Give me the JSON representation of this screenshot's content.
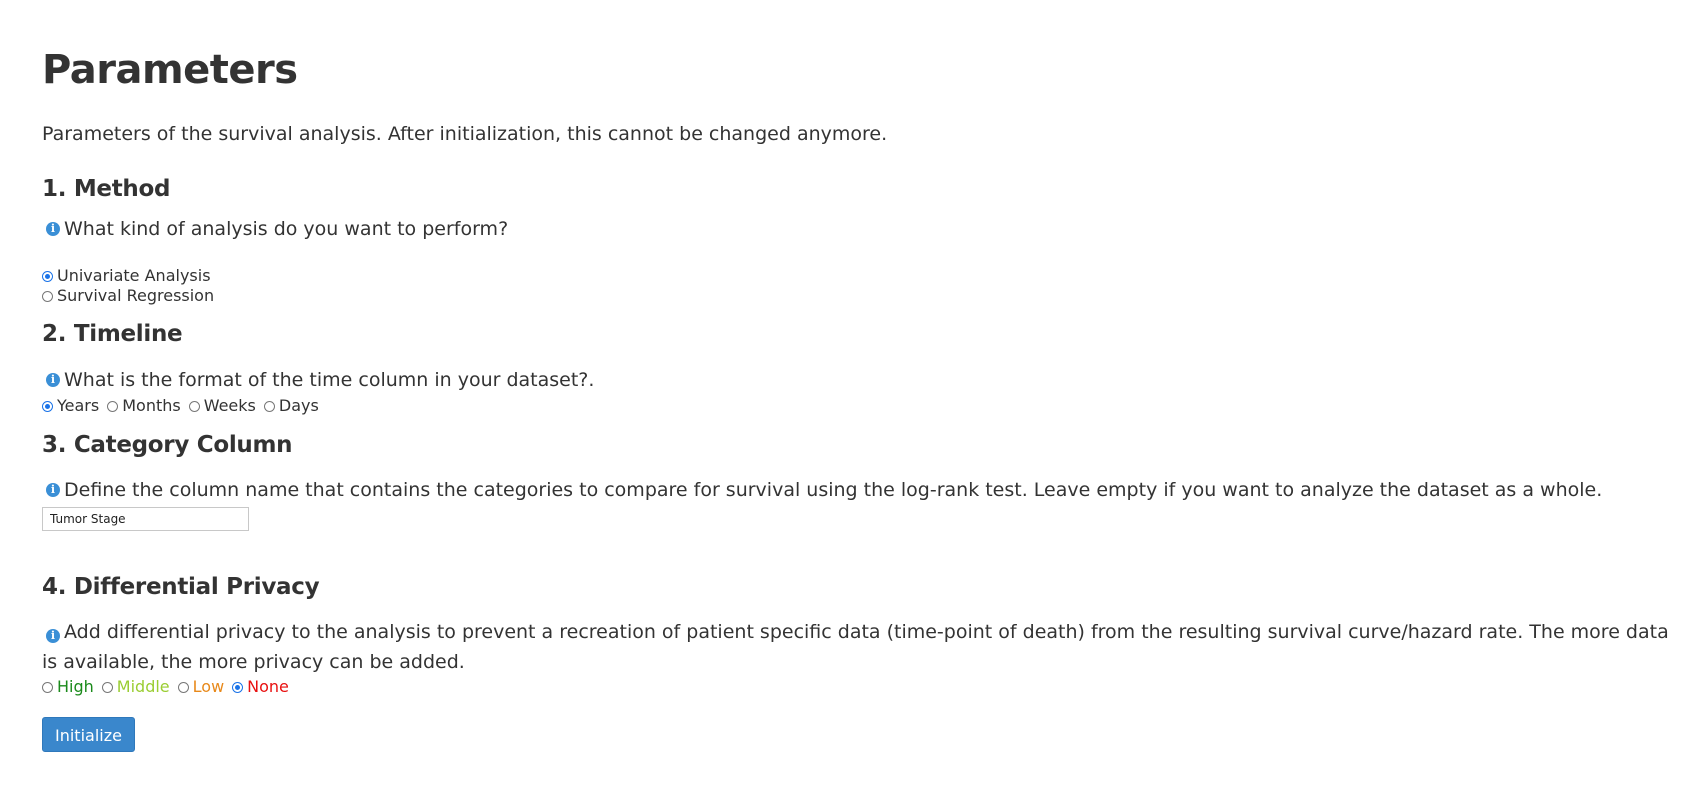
{
  "page": {
    "title": "Parameters",
    "subtitle": "Parameters of the survival analysis. After initialization, this cannot be changed anymore."
  },
  "method": {
    "heading": "1. Method",
    "question": "What kind of analysis do you want to perform?",
    "options": [
      {
        "label": "Univariate Analysis",
        "checked": true
      },
      {
        "label": "Survival Regression",
        "checked": false
      }
    ]
  },
  "timeline": {
    "heading": "2. Timeline",
    "question": "What is the format of the time column in your dataset?.",
    "options": [
      {
        "label": "Years",
        "checked": true
      },
      {
        "label": "Months",
        "checked": false
      },
      {
        "label": "Weeks",
        "checked": false
      },
      {
        "label": "Days",
        "checked": false
      }
    ]
  },
  "category": {
    "heading": "3. Category Column",
    "question": "Define the column name that contains the categories to compare for survival using the log-rank test. Leave empty if you want to analyze the dataset as a whole.",
    "input_value": "Tumor Stage"
  },
  "privacy": {
    "heading": "4. Differential Privacy",
    "question": "Add differential privacy to the analysis to prevent a recreation of patient specific data (time-point of death) from the resulting survival curve/hazard rate. The more data is available, the more privacy can be added.",
    "options": [
      {
        "label": "High",
        "checked": false,
        "color": "#1a8a1a"
      },
      {
        "label": "Middle",
        "checked": false,
        "color": "#9acd32"
      },
      {
        "label": "Low",
        "checked": false,
        "color": "#e8891a"
      },
      {
        "label": "None",
        "checked": true,
        "color": "#e81010"
      }
    ]
  },
  "actions": {
    "initialize_label": "Initialize"
  },
  "colors": {
    "accent": "#3a87cc",
    "info_icon": "#3a8fd6",
    "text": "#333333"
  },
  "icons": {
    "info": "info-icon"
  }
}
